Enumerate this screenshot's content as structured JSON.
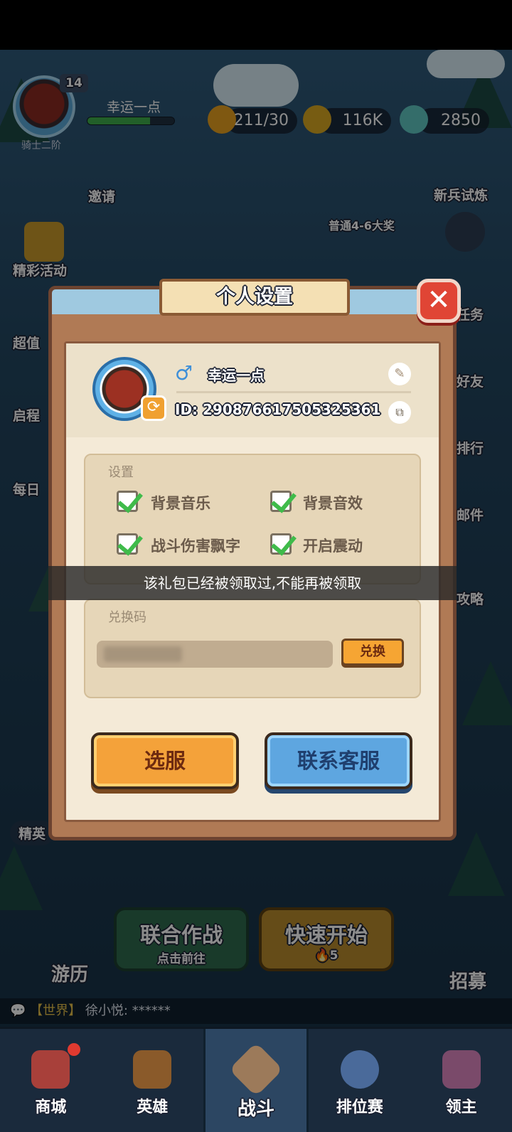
{
  "hud": {
    "level": "14",
    "rank": "骑士二阶",
    "player_name": "幸运一点",
    "xp_progress": 0.72,
    "stamina": "211/30",
    "gold": "116K",
    "gems": "2850",
    "invite": "邀请",
    "new_trial": "新兵试炼",
    "bonus": "普通4-6大奖"
  },
  "left_menu": [
    "精彩活动",
    "超值",
    "启程",
    "每日"
  ],
  "right_menu": [
    "任务",
    "好友",
    "排行",
    "邮件",
    "攻略"
  ],
  "dialog": {
    "title": "个人设置",
    "close_icon": "close-icon",
    "profile": {
      "gender_symbol": "♂",
      "name": "幸运一点",
      "id": "ID: 2908766175053253​61"
    },
    "settings_label": "设置",
    "options": [
      {
        "label": "背景音乐",
        "checked": true
      },
      {
        "label": "背景音效",
        "checked": true
      },
      {
        "label": "战斗伤害飘字",
        "checked": true
      },
      {
        "label": "开启震动",
        "checked": true
      }
    ],
    "redeem_label": "兑换码",
    "redeem_button": "兑换",
    "server_button": "选服",
    "support_button": "联系客服"
  },
  "toast": "该礼包已经被领取过,不能再被领取",
  "background": {
    "elite": "精英",
    "travel": "游历",
    "coop_title": "联合作战",
    "coop_sub": "点击前往",
    "quick_title": "快速开始",
    "quick_cost": "5",
    "recruit": "招募",
    "chat_channel": "【世界】",
    "chat_user": "徐小悦:",
    "chat_msg": "******"
  },
  "nav": {
    "items": [
      {
        "label": "商城",
        "icon": "shop-icon"
      },
      {
        "label": "英雄",
        "icon": "hero-card-icon"
      },
      {
        "label": "战斗",
        "icon": "swords-icon"
      },
      {
        "label": "排位赛",
        "icon": "rank-shield-icon"
      },
      {
        "label": "领主",
        "icon": "lord-castle-icon"
      }
    ],
    "active": "战斗"
  },
  "colors": {
    "panel": "#f4ead7",
    "frame": "#b07a55",
    "orange_button": "#f4a23a",
    "blue_button": "#5ea6e0",
    "check_green": "#3fbb4a"
  }
}
